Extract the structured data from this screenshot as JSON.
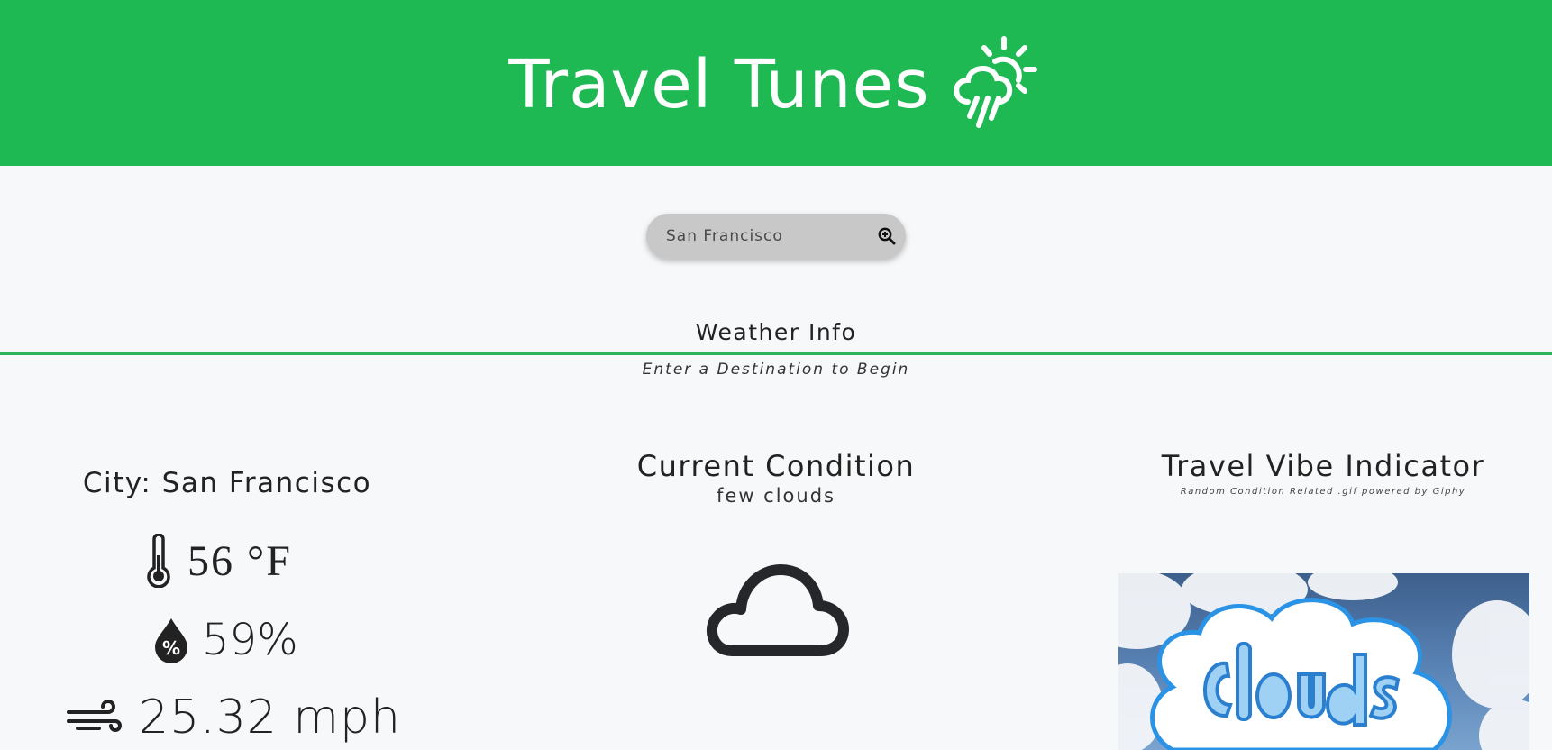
{
  "header": {
    "title": "Travel Tunes",
    "logo_icon": "cloud-sun-rain-icon",
    "background": "#1fb954"
  },
  "search": {
    "value": "San Francisco",
    "button_icon": "zoom-in-icon"
  },
  "weather_section": {
    "title": "Weather Info",
    "subtitle": "Enter a Destination to Begin"
  },
  "city_panel": {
    "city": "City: San Francisco",
    "temperature": "56 °F",
    "temperature_icon": "thermometer-icon",
    "humidity": "59%",
    "humidity_icon": "humidity-drop-icon",
    "wind": "25.32 mph",
    "wind_icon": "wind-icon"
  },
  "condition_panel": {
    "title": "Current Condition",
    "description": "few clouds",
    "icon": "cloud-icon"
  },
  "vibe_panel": {
    "title": "Travel Vibe Indicator",
    "subtitle": "Random Condition Related .gif powered by Giphy",
    "gif_text": "Clouds"
  },
  "colors": {
    "accent": "#1fb954",
    "divider": "#2fb35a",
    "page_bg": "#f7f8fa"
  }
}
